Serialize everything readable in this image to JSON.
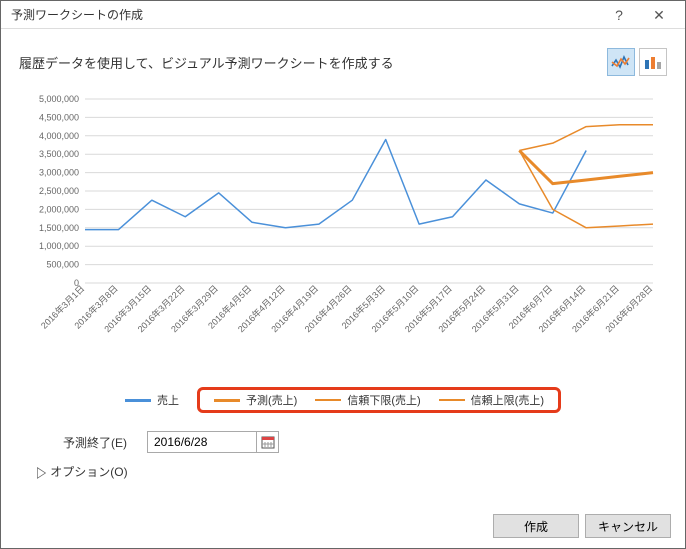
{
  "dialog_title": "予測ワークシートの作成",
  "subtitle": "履歴データを使用して、ビジュアル予測ワークシートを作成する",
  "form": {
    "date_label": "予測終了(E)",
    "date_value": "2016/6/28"
  },
  "options_label": "オプション(O)",
  "buttons": {
    "ok": "作成",
    "cancel": "キャンセル"
  },
  "legend": {
    "sales": "売上",
    "forecast": "予測(売上)",
    "lower": "信頼下限(売上)",
    "upper": "信頼上限(売上)"
  },
  "chart_data": {
    "type": "line",
    "title": "",
    "xlabel": "",
    "ylabel": "",
    "ylim": [
      0,
      5000000
    ],
    "yticks": [
      0,
      500000,
      1000000,
      1500000,
      2000000,
      2500000,
      3000000,
      3500000,
      4000000,
      4500000,
      5000000
    ],
    "categories": [
      "2016年3月1日",
      "2016年3月8日",
      "2016年3月15日",
      "2016年3月22日",
      "2016年3月29日",
      "2016年4月5日",
      "2016年4月12日",
      "2016年4月19日",
      "2016年4月26日",
      "2016年5月3日",
      "2016年5月10日",
      "2016年5月17日",
      "2016年5月24日",
      "2016年5月31日",
      "2016年6月7日",
      "2016年6月14日",
      "2016年6月21日",
      "2016年6月28日"
    ],
    "series": [
      {
        "name": "売上",
        "color": "#4a90d9",
        "values": [
          1450000,
          1450000,
          2250000,
          1800000,
          2450000,
          1650000,
          1500000,
          1600000,
          2250000,
          3900000,
          1600000,
          1800000,
          2800000,
          2150000,
          1900000,
          3600000,
          null,
          null,
          null,
          null
        ]
      },
      {
        "name": "予測(売上)",
        "color": "#e88a2a",
        "thick": true,
        "values": [
          null,
          null,
          null,
          null,
          null,
          null,
          null,
          null,
          null,
          null,
          null,
          null,
          null,
          3600000,
          2700000,
          2800000,
          2900000,
          3000000
        ]
      },
      {
        "name": "信頼下限(売上)",
        "color": "#e88a2a",
        "values": [
          null,
          null,
          null,
          null,
          null,
          null,
          null,
          null,
          null,
          null,
          null,
          null,
          null,
          3600000,
          2000000,
          1500000,
          1550000,
          1600000
        ]
      },
      {
        "name": "信頼上限(売上)",
        "color": "#e88a2a",
        "values": [
          null,
          null,
          null,
          null,
          null,
          null,
          null,
          null,
          null,
          null,
          null,
          null,
          null,
          3600000,
          3800000,
          4250000,
          4300000,
          4300000
        ]
      }
    ]
  }
}
